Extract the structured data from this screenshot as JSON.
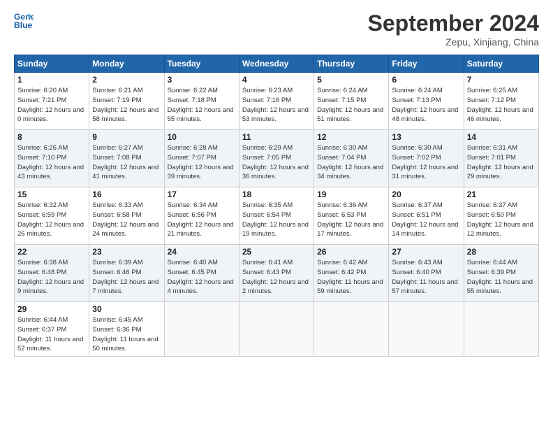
{
  "header": {
    "logo_line1": "General",
    "logo_line2": "Blue",
    "month": "September 2024",
    "location": "Zepu, Xinjiang, China"
  },
  "weekdays": [
    "Sunday",
    "Monday",
    "Tuesday",
    "Wednesday",
    "Thursday",
    "Friday",
    "Saturday"
  ],
  "weeks": [
    [
      {
        "day": 1,
        "sunrise": "6:20 AM",
        "sunset": "7:21 PM",
        "daylight": "12 hours and 0 minutes."
      },
      {
        "day": 2,
        "sunrise": "6:21 AM",
        "sunset": "7:19 PM",
        "daylight": "12 hours and 58 minutes."
      },
      {
        "day": 3,
        "sunrise": "6:22 AM",
        "sunset": "7:18 PM",
        "daylight": "12 hours and 55 minutes."
      },
      {
        "day": 4,
        "sunrise": "6:23 AM",
        "sunset": "7:16 PM",
        "daylight": "12 hours and 53 minutes."
      },
      {
        "day": 5,
        "sunrise": "6:24 AM",
        "sunset": "7:15 PM",
        "daylight": "12 hours and 51 minutes."
      },
      {
        "day": 6,
        "sunrise": "6:24 AM",
        "sunset": "7:13 PM",
        "daylight": "12 hours and 48 minutes."
      },
      {
        "day": 7,
        "sunrise": "6:25 AM",
        "sunset": "7:12 PM",
        "daylight": "12 hours and 46 minutes."
      }
    ],
    [
      {
        "day": 8,
        "sunrise": "6:26 AM",
        "sunset": "7:10 PM",
        "daylight": "12 hours and 43 minutes."
      },
      {
        "day": 9,
        "sunrise": "6:27 AM",
        "sunset": "7:08 PM",
        "daylight": "12 hours and 41 minutes."
      },
      {
        "day": 10,
        "sunrise": "6:28 AM",
        "sunset": "7:07 PM",
        "daylight": "12 hours and 39 minutes."
      },
      {
        "day": 11,
        "sunrise": "6:29 AM",
        "sunset": "7:05 PM",
        "daylight": "12 hours and 36 minutes."
      },
      {
        "day": 12,
        "sunrise": "6:30 AM",
        "sunset": "7:04 PM",
        "daylight": "12 hours and 34 minutes."
      },
      {
        "day": 13,
        "sunrise": "6:30 AM",
        "sunset": "7:02 PM",
        "daylight": "12 hours and 31 minutes."
      },
      {
        "day": 14,
        "sunrise": "6:31 AM",
        "sunset": "7:01 PM",
        "daylight": "12 hours and 29 minutes."
      }
    ],
    [
      {
        "day": 15,
        "sunrise": "6:32 AM",
        "sunset": "6:59 PM",
        "daylight": "12 hours and 26 minutes."
      },
      {
        "day": 16,
        "sunrise": "6:33 AM",
        "sunset": "6:58 PM",
        "daylight": "12 hours and 24 minutes."
      },
      {
        "day": 17,
        "sunrise": "6:34 AM",
        "sunset": "6:56 PM",
        "daylight": "12 hours and 21 minutes."
      },
      {
        "day": 18,
        "sunrise": "6:35 AM",
        "sunset": "6:54 PM",
        "daylight": "12 hours and 19 minutes."
      },
      {
        "day": 19,
        "sunrise": "6:36 AM",
        "sunset": "6:53 PM",
        "daylight": "12 hours and 17 minutes."
      },
      {
        "day": 20,
        "sunrise": "6:37 AM",
        "sunset": "6:51 PM",
        "daylight": "12 hours and 14 minutes."
      },
      {
        "day": 21,
        "sunrise": "6:37 AM",
        "sunset": "6:50 PM",
        "daylight": "12 hours and 12 minutes."
      }
    ],
    [
      {
        "day": 22,
        "sunrise": "6:38 AM",
        "sunset": "6:48 PM",
        "daylight": "12 hours and 9 minutes."
      },
      {
        "day": 23,
        "sunrise": "6:39 AM",
        "sunset": "6:46 PM",
        "daylight": "12 hours and 7 minutes."
      },
      {
        "day": 24,
        "sunrise": "6:40 AM",
        "sunset": "6:45 PM",
        "daylight": "12 hours and 4 minutes."
      },
      {
        "day": 25,
        "sunrise": "6:41 AM",
        "sunset": "6:43 PM",
        "daylight": "12 hours and 2 minutes."
      },
      {
        "day": 26,
        "sunrise": "6:42 AM",
        "sunset": "6:42 PM",
        "daylight": "11 hours and 59 minutes."
      },
      {
        "day": 27,
        "sunrise": "6:43 AM",
        "sunset": "6:40 PM",
        "daylight": "11 hours and 57 minutes."
      },
      {
        "day": 28,
        "sunrise": "6:44 AM",
        "sunset": "6:39 PM",
        "daylight": "11 hours and 55 minutes."
      }
    ],
    [
      {
        "day": 29,
        "sunrise": "6:44 AM",
        "sunset": "6:37 PM",
        "daylight": "11 hours and 52 minutes."
      },
      {
        "day": 30,
        "sunrise": "6:45 AM",
        "sunset": "6:36 PM",
        "daylight": "11 hours and 50 minutes."
      },
      null,
      null,
      null,
      null,
      null
    ]
  ]
}
